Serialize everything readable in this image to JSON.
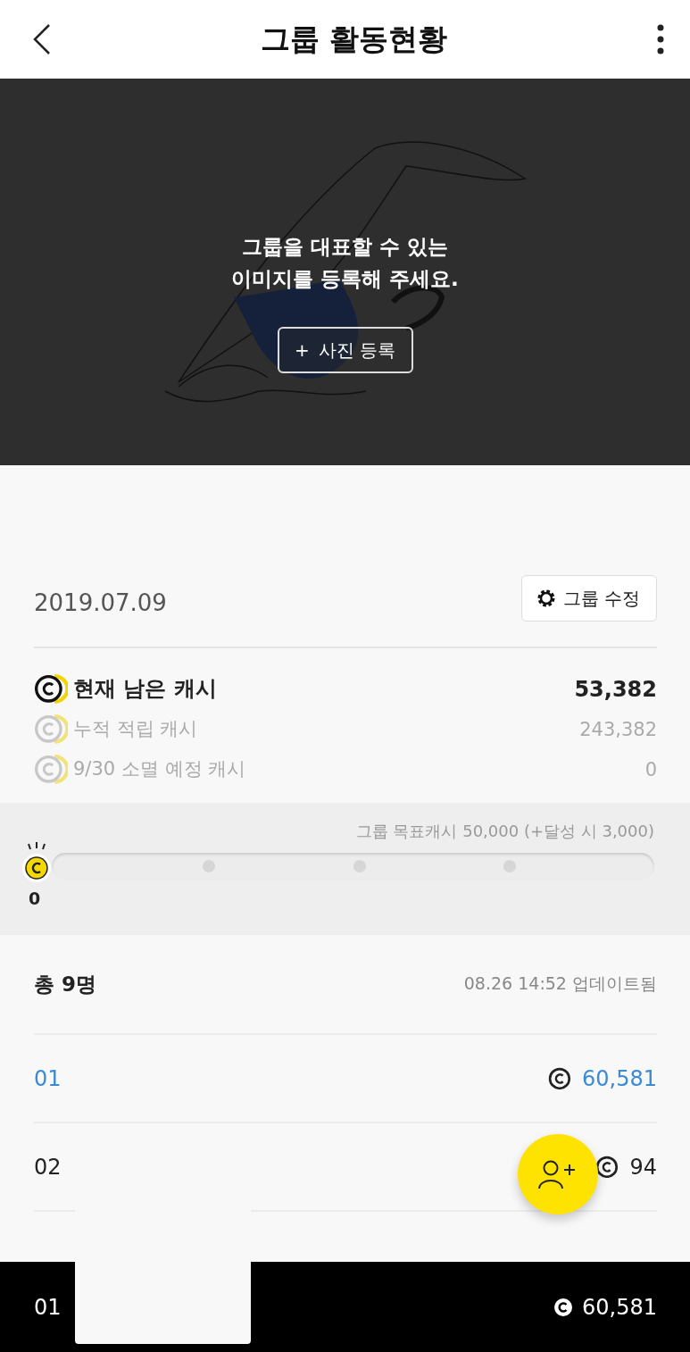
{
  "header": {
    "title": "그룹 활동현황"
  },
  "hero": {
    "message_lines": [
      "그룹을 대표할 수 있는",
      "이미지를 등록해 주세요."
    ],
    "add_photo_button": {
      "icon": "+",
      "label": "사진 등록"
    }
  },
  "summary": {
    "date": "2019.07.09",
    "edit_button": "그룹 수정",
    "cash_rows": [
      {
        "kind": "primary",
        "label": "현재 남은 캐시",
        "amount": "53,382"
      },
      {
        "kind": "secondary",
        "label": "누적 적립 캐시",
        "amount": "243,382"
      },
      {
        "kind": "secondary",
        "label": "9/30 소멸 예정 캐시",
        "amount": "0"
      }
    ]
  },
  "goal": {
    "caption": "그룹 목표캐시 50,000 (+달성 시 3,000)",
    "level": 0,
    "current": "0"
  },
  "members": {
    "total": "총 9명",
    "updated": "08.26 14:52 업데이트됨",
    "rows": [
      {
        "rank": "01",
        "amount": "60,581",
        "selected": true
      },
      {
        "rank": "02",
        "amount": "94",
        "selected": false
      }
    ]
  },
  "my_rank_bar": {
    "rank": "01",
    "amount": "60,581"
  }
}
